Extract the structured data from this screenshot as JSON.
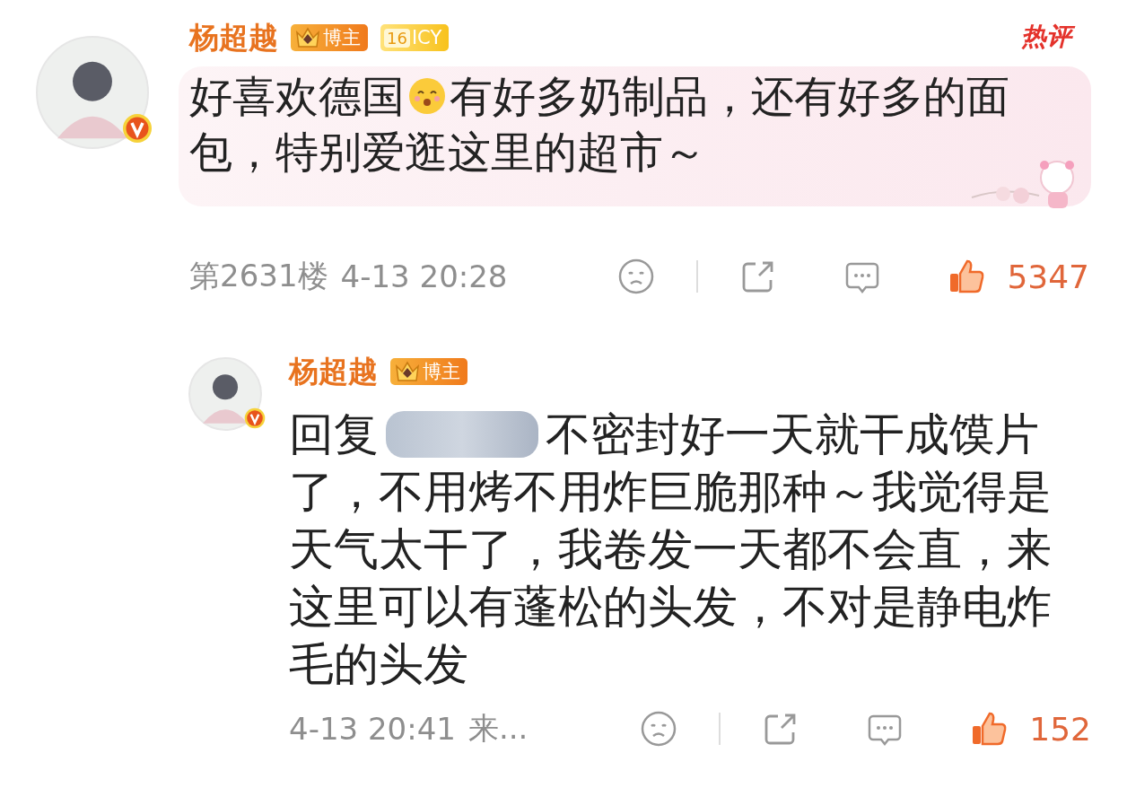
{
  "comment": {
    "author": "杨超越",
    "verified": true,
    "hot_label": "热评",
    "badges": [
      {
        "kind": "crown",
        "label": "博主"
      },
      {
        "kind": "level",
        "number": "16",
        "label": "ICY"
      }
    ],
    "lines": [
      [
        {
          "kind": "text",
          "text": "好喜欢德国"
        },
        {
          "kind": "emoji"
        },
        {
          "kind": "text",
          "text": "有好多奶制品，还有好多的面"
        }
      ],
      [
        {
          "kind": "text",
          "text": "包，特别爱逛这里的超市～"
        }
      ]
    ],
    "floor": "第2631楼",
    "time": "4-13 20:28",
    "likes": "5347"
  },
  "reply": {
    "author": "杨超越",
    "verified": true,
    "badges": [
      {
        "kind": "crown",
        "label": "博主"
      }
    ],
    "lines": [
      [
        {
          "kind": "text",
          "text": "回复"
        },
        {
          "kind": "redacted"
        },
        {
          "kind": "text",
          "text": "不密封好一天就干成馍片"
        }
      ],
      [
        {
          "kind": "text",
          "text": "了，不用烤不用炸巨脆那种～我觉得是"
        }
      ],
      [
        {
          "kind": "text",
          "text": "天气太干了，我卷发一天都不会直，来"
        }
      ],
      [
        {
          "kind": "text",
          "text": "这里可以有蓬松的头发，不对是静电炸"
        }
      ],
      [
        {
          "kind": "text",
          "text": "毛的头发"
        }
      ]
    ],
    "time": "4-13 20:41",
    "source": "来...",
    "likes": "152"
  }
}
